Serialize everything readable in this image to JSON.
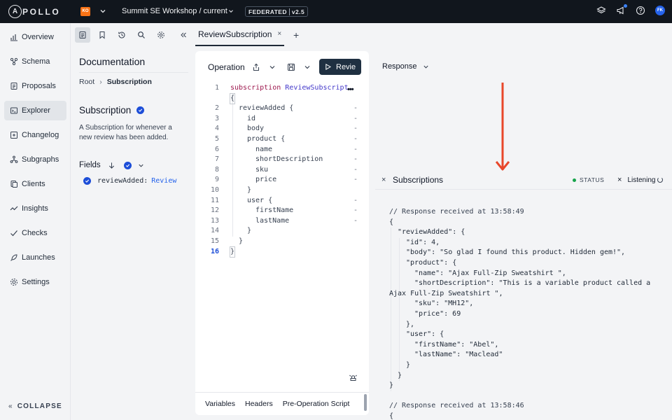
{
  "topbar": {
    "logo_mark": "A",
    "logo_text": "POLLO",
    "org_initials": "KO",
    "graph_title": "Summit SE Workshop / current",
    "badge_left": "FEDERATED",
    "badge_right": "v2.5",
    "avatar_initials": "FK"
  },
  "nav": {
    "items": [
      {
        "label": "Overview",
        "icon": "overview-icon"
      },
      {
        "label": "Schema",
        "icon": "schema-icon"
      },
      {
        "label": "Proposals",
        "icon": "proposals-icon"
      },
      {
        "label": "Explorer",
        "icon": "explorer-icon",
        "active": true
      },
      {
        "label": "Changelog",
        "icon": "changelog-icon"
      },
      {
        "label": "Subgraphs",
        "icon": "subgraphs-icon"
      },
      {
        "label": "Clients",
        "icon": "clients-icon"
      },
      {
        "label": "Insights",
        "icon": "insights-icon"
      },
      {
        "label": "Checks",
        "icon": "checks-icon"
      },
      {
        "label": "Launches",
        "icon": "launches-icon"
      },
      {
        "label": "Settings",
        "icon": "settings-icon"
      }
    ],
    "collapse_label": "COLLAPSE"
  },
  "docs": {
    "title": "Documentation",
    "breadcrumb_root": "Root",
    "breadcrumb_current": "Subscription",
    "type_title": "Subscription",
    "type_description": "A Subscription for whenever a new review has been added.",
    "fields_label": "Fields",
    "field_name": "reviewAdded:",
    "field_type": "Review"
  },
  "tabs": {
    "active_tab": "ReviewSubscription",
    "close_glyph": "×",
    "add_glyph": "+"
  },
  "operation": {
    "label": "Operation",
    "run_label": "Revie",
    "more_glyph": "•••",
    "bottom_tabs": [
      "Variables",
      "Headers",
      "Pre-Operation Script"
    ],
    "lines": [
      {
        "n": "1",
        "indent": 0,
        "text": "subscription ReviewSubscript"
      },
      {
        "n": "",
        "indent": 0,
        "text": "{"
      },
      {
        "n": "2",
        "indent": 1,
        "text": "reviewAdded {",
        "dash": true
      },
      {
        "n": "3",
        "indent": 2,
        "text": "id",
        "dash": true
      },
      {
        "n": "4",
        "indent": 2,
        "text": "body",
        "dash": true
      },
      {
        "n": "5",
        "indent": 2,
        "text": "product {",
        "dash": true
      },
      {
        "n": "6",
        "indent": 3,
        "text": "name",
        "dash": true
      },
      {
        "n": "7",
        "indent": 3,
        "text": "shortDescription",
        "dash": true
      },
      {
        "n": "8",
        "indent": 3,
        "text": "sku",
        "dash": true
      },
      {
        "n": "9",
        "indent": 3,
        "text": "price",
        "dash": true
      },
      {
        "n": "10",
        "indent": 2,
        "text": "}"
      },
      {
        "n": "11",
        "indent": 2,
        "text": "user {",
        "dash": true
      },
      {
        "n": "12",
        "indent": 3,
        "text": "firstName",
        "dash": true
      },
      {
        "n": "13",
        "indent": 3,
        "text": "lastName",
        "dash": true
      },
      {
        "n": "14",
        "indent": 2,
        "text": "}"
      },
      {
        "n": "15",
        "indent": 1,
        "text": "}"
      },
      {
        "n": "16",
        "indent": 0,
        "text": "}",
        "current": true
      }
    ]
  },
  "response": {
    "label": "Response",
    "subscriptions_title": "Subscriptions",
    "status_label": "STATUS",
    "listening_label": "Listening",
    "close_glyph": "×",
    "lines": [
      {
        "indent": 0,
        "text": "// Response received at 13:58:49",
        "cls": "rc"
      },
      {
        "indent": 0,
        "text": "{"
      },
      {
        "indent": 1,
        "text": "\"reviewAdded\": {"
      },
      {
        "indent": 2,
        "text": "\"id\": 4,"
      },
      {
        "indent": 2,
        "text": "\"body\": \"So glad I found this product. Hidden gem!\","
      },
      {
        "indent": 2,
        "text": "\"product\": {"
      },
      {
        "indent": 3,
        "text": "\"name\": \"Ajax Full-Zip Sweatshirt \","
      },
      {
        "indent": 3,
        "text": "\"shortDescription\": \"This is a variable product called a"
      },
      {
        "indent": 0,
        "text": "Ajax Full-Zip Sweatshirt \","
      },
      {
        "indent": 3,
        "text": "\"sku\": \"MH12\","
      },
      {
        "indent": 3,
        "text": "\"price\": 69"
      },
      {
        "indent": 2,
        "text": "},"
      },
      {
        "indent": 2,
        "text": "\"user\": {"
      },
      {
        "indent": 3,
        "text": "\"firstName\": \"Abel\","
      },
      {
        "indent": 3,
        "text": "\"lastName\": \"Maclead\""
      },
      {
        "indent": 2,
        "text": "}"
      },
      {
        "indent": 1,
        "text": "}"
      },
      {
        "indent": 0,
        "text": "}"
      },
      {
        "indent": 0,
        "text": ""
      },
      {
        "indent": 0,
        "text": "// Response received at 13:58:46",
        "cls": "rc"
      },
      {
        "indent": 0,
        "text": "{"
      }
    ]
  },
  "colors": {
    "topbar_bg": "#11161d",
    "run_button": "#1f3041",
    "annotation_arrow": "#e8472b",
    "status_green": "#16a34a",
    "check_blue": "#1d4ed8"
  }
}
